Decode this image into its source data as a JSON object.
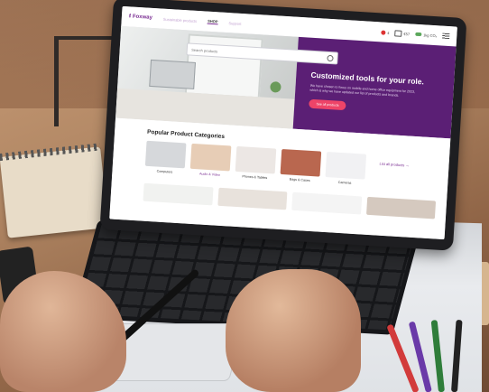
{
  "site": {
    "logo": "Foxway",
    "nav": [
      "Sustainable products",
      "SHOP",
      "Support"
    ],
    "active_nav": "SHOP"
  },
  "header": {
    "counter_value": "4",
    "cart_value": "€57",
    "co2_value": "1kg CO₂"
  },
  "search": {
    "placeholder": "Search products"
  },
  "hero": {
    "title": "Customized tools for your role.",
    "text": "We have chosen to focus on mobile and home office equipment for 2023, which is why we have updated our list of products and brands.",
    "button": "See all products"
  },
  "categories_section": {
    "title": "Popular Product Categories",
    "list_link": "List all products →",
    "items": [
      {
        "label": "Computers",
        "color": "#d6d8db"
      },
      {
        "label": "Audio & Video",
        "color": "#e7cdb6"
      },
      {
        "label": "Phones & Tablets",
        "color": "#ece7e4"
      },
      {
        "label": "Bags & Cases",
        "color": "#b9674f"
      },
      {
        "label": "Cameras",
        "color": "#f1f1f3"
      }
    ]
  },
  "colors": {
    "brand_purple": "#5b1f75",
    "accent_pink": "#ee4468",
    "link_purple": "#7a2d92"
  }
}
